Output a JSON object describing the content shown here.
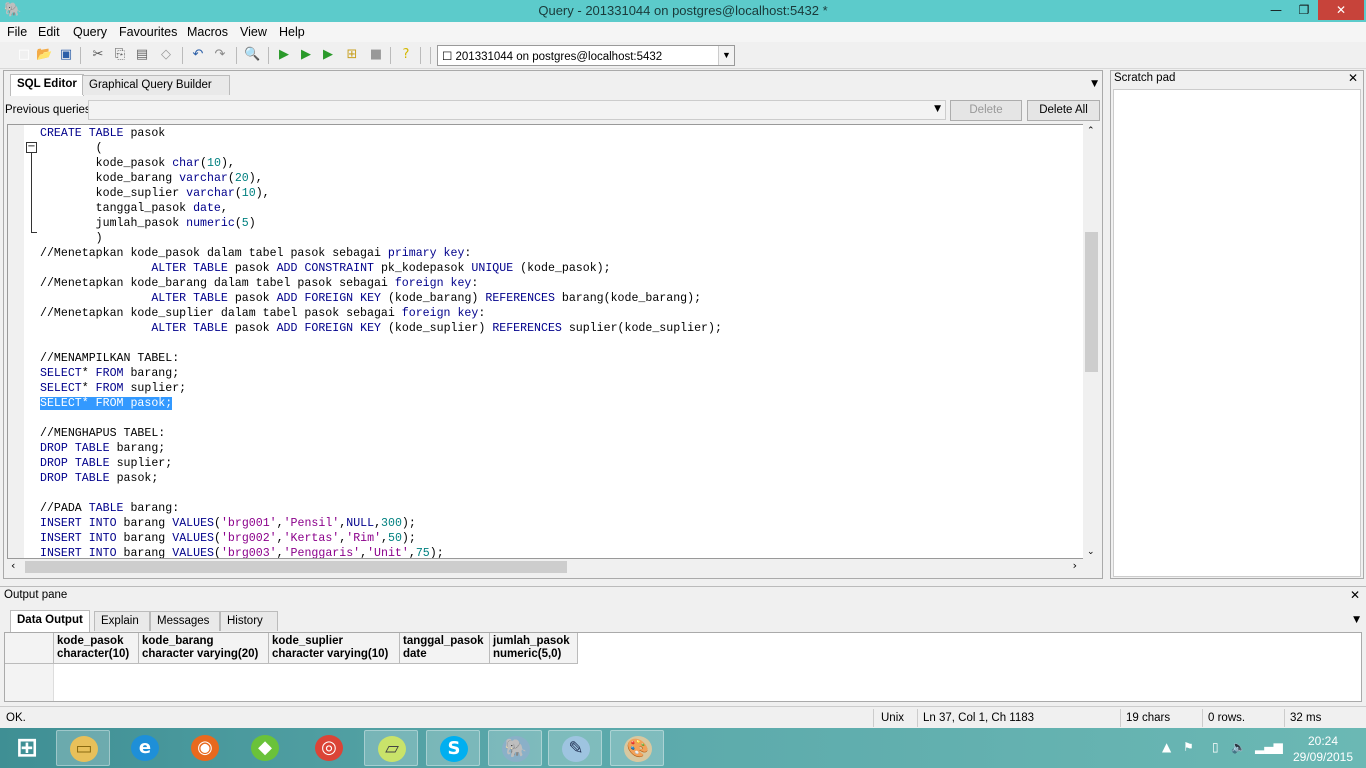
{
  "window": {
    "title": "Query - 201331044 on postgres@localhost:5432 *",
    "minimize": "—",
    "maximize": "❐",
    "close": "✕"
  },
  "menu": [
    "File",
    "Edit",
    "Query",
    "Favourites",
    "Macros",
    "View",
    "Help"
  ],
  "toolbar": {
    "icons": [
      "new-icon",
      "open-icon",
      "save-icon",
      "cut-icon",
      "copy-icon",
      "paste-icon",
      "clear-icon",
      "undo-icon",
      "redo-icon",
      "find-icon",
      "execute-icon",
      "execute-pgscript-icon",
      "execute-to-file-icon",
      "explain-icon",
      "cancel-icon",
      "help-icon"
    ],
    "connection": "☐ 201331044 on postgres@localhost:5432"
  },
  "editor_tabs": [
    "SQL Editor",
    "Graphical Query Builder"
  ],
  "previous_queries": {
    "label": "Previous queries",
    "value": "",
    "delete": "Delete",
    "delete_all": "Delete All"
  },
  "editor": {
    "selected_line": 18,
    "lines": [
      "CREATE TABLE pasok",
      "        (",
      "        kode_pasok char(10),",
      "        kode_barang varchar(20),",
      "        kode_suplier varchar(10),",
      "        tanggal_pasok date,",
      "        jumlah_pasok numeric(5)",
      "        )",
      "//Menetapkan kode_pasok dalam tabel pasok sebagai primary key:",
      "                ALTER TABLE pasok ADD CONSTRAINT pk_kodepasok UNIQUE (kode_pasok);",
      "//Menetapkan kode_barang dalam tabel pasok sebagai foreign key:",
      "                ALTER TABLE pasok ADD FOREIGN KEY (kode_barang) REFERENCES barang(kode_barang);",
      "//Menetapkan kode_suplier dalam tabel pasok sebagai foreign key:",
      "                ALTER TABLE pasok ADD FOREIGN KEY (kode_suplier) REFERENCES suplier(kode_suplier);",
      "",
      "//MENAMPILKAN TABEL:",
      "SELECT* FROM barang;",
      "SELECT* FROM suplier;",
      "SELECT* FROM pasok;",
      "",
      "//MENGHAPUS TABEL:",
      "DROP TABLE barang;",
      "DROP TABLE suplier;",
      "DROP TABLE pasok;",
      "",
      "//PADA TABLE barang:",
      "INSERT INTO barang VALUES('brg001','Pensil',NULL,300);",
      "INSERT INTO barang VALUES('brg002','Kertas','Rim',50);",
      "INSERT INTO barang VALUES('brg003','Penggaris','Unit',75);"
    ]
  },
  "scratch_pad": {
    "title": "Scratch pad"
  },
  "output": {
    "title": "Output pane",
    "tabs": [
      "Data Output",
      "Explain",
      "Messages",
      "History"
    ],
    "columns": [
      {
        "name": "kode_pasok",
        "type": "character(10)"
      },
      {
        "name": "kode_barang",
        "type": "character varying(20)"
      },
      {
        "name": "kode_suplier",
        "type": "character varying(10)"
      },
      {
        "name": "tanggal_pasok",
        "type": "date"
      },
      {
        "name": "jumlah_pasok",
        "type": "numeric(5,0)"
      }
    ]
  },
  "status": {
    "message": "OK.",
    "line_endings": "Unix",
    "position": "Ln 37, Col 1, Ch 1183",
    "selection": "19 chars",
    "rows": "0 rows.",
    "time": "32 ms"
  },
  "taskbar": {
    "apps": [
      "start-icon",
      "file-explorer-icon",
      "internet-explorer-icon",
      "firefox-icon",
      "bluestacks-icon",
      "chrome-icon",
      "notes-icon",
      "skype-icon",
      "pgadmin-icon",
      "notepad-icon",
      "paint-icon"
    ],
    "time": "20:24",
    "date": "29/09/2015"
  },
  "colors": {
    "titlebar": "#5ccbcb",
    "keyword": "#00008b",
    "string": "#8b008b",
    "number": "#008080",
    "selection": "#3399ff"
  }
}
